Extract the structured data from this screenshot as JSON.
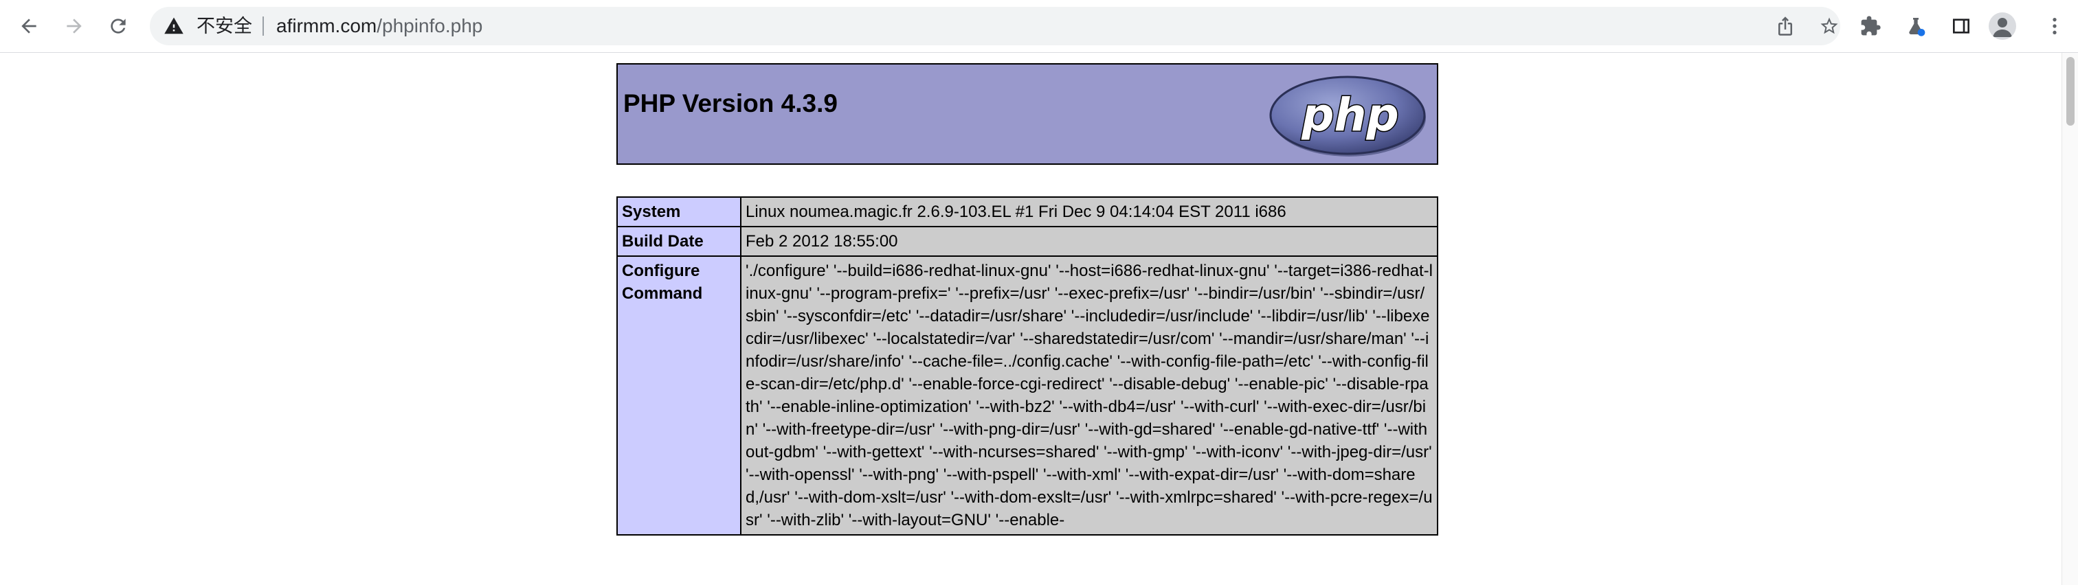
{
  "browser": {
    "security_label": "不安全",
    "url_host": "afirmm.com",
    "url_path": "/phpinfo.php",
    "icons": [
      "back-icon",
      "forward-icon",
      "reload-icon",
      "warning-icon",
      "share-icon",
      "star-icon",
      "extensions-icon",
      "lab-icon",
      "side-panel-icon",
      "avatar-icon",
      "menu-icon"
    ]
  },
  "header": {
    "title": "PHP Version 4.3.9",
    "logo_text": "php"
  },
  "info_rows": [
    {
      "label": "System",
      "value": "Linux noumea.magic.fr 2.6.9-103.EL #1 Fri Dec 9 04:14:04 EST 2011 i686"
    },
    {
      "label": "Build Date",
      "value": "Feb 2 2012 18:55:00"
    },
    {
      "label": "Configure Command",
      "value": "'./configure' '--build=i686-redhat-linux-gnu' '--host=i686-redhat-linux-gnu' '--target=i386-redhat-linux-gnu' '--program-prefix=' '--prefix=/usr' '--exec-prefix=/usr' '--bindir=/usr/bin' '--sbindir=/usr/sbin' '--sysconfdir=/etc' '--datadir=/usr/share' '--includedir=/usr/include' '--libdir=/usr/lib' '--libexecdir=/usr/libexec' '--localstatedir=/var' '--sharedstatedir=/usr/com' '--mandir=/usr/share/man' '--infodir=/usr/share/info' '--cache-file=../config.cache' '--with-config-file-path=/etc' '--with-config-file-scan-dir=/etc/php.d' '--enable-force-cgi-redirect' '--disable-debug' '--enable-pic' '--disable-rpath' '--enable-inline-optimization' '--with-bz2' '--with-db4=/usr' '--with-curl' '--with-exec-dir=/usr/bin' '--with-freetype-dir=/usr' '--with-png-dir=/usr' '--with-gd=shared' '--enable-gd-native-ttf' '--without-gdbm' '--with-gettext' '--with-ncurses=shared' '--with-gmp' '--with-iconv' '--with-jpeg-dir=/usr' '--with-openssl' '--with-png' '--with-pspell' '--with-xml' '--with-expat-dir=/usr' '--with-dom=shared,/usr' '--with-dom-xslt=/usr' '--with-dom-exslt=/usr' '--with-xmlrpc=shared' '--with-pcre-regex=/usr' '--with-zlib' '--with-layout=GNU' '--enable-"
    }
  ]
}
